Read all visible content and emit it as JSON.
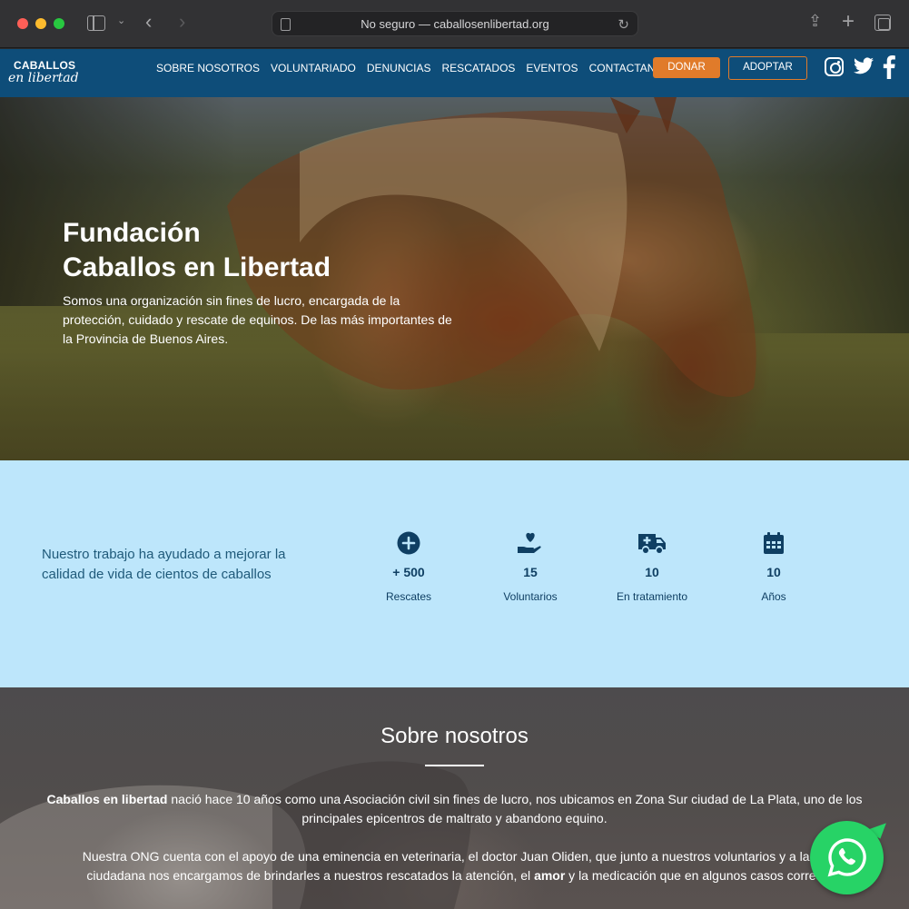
{
  "browser": {
    "url_text": "No seguro — caballosenlibertad.org"
  },
  "site": {
    "logo_line1": "CABALLOS",
    "logo_line2": "en libertad",
    "nav": [
      {
        "label": "SOBRE NOSOTROS"
      },
      {
        "label": "VOLUNTARIADO"
      },
      {
        "label": "DENUNCIAS"
      },
      {
        "label": "RESCATADOS"
      },
      {
        "label": "EVENTOS"
      },
      {
        "label": "CONTACTANOS"
      }
    ],
    "donate_label": "DONAR",
    "adopt_label": "ADOPTAR",
    "social_icons": [
      "instagram-icon",
      "twitter-icon",
      "facebook-icon"
    ]
  },
  "hero": {
    "title_line1": "Fundación",
    "title_line2": "Caballos en Libertad",
    "description": "Somos una organización sin fines de lucro, encargada de la protección, cuidado y rescate de equinos. De las más importantes de la Provincia de Buenos Aires."
  },
  "stats": {
    "intro": "Nuestro trabajo ha ayudado a mejorar la calidad de vida de cientos de caballos",
    "items": [
      {
        "icon": "plus-circle-icon",
        "value": "+ 500",
        "label": "Rescates"
      },
      {
        "icon": "hand-heart-icon",
        "value": "15",
        "label": "Voluntarios"
      },
      {
        "icon": "ambulance-icon",
        "value": "10",
        "label": "En tratamiento"
      },
      {
        "icon": "calendar-icon",
        "value": "10",
        "label": "Años"
      }
    ]
  },
  "about": {
    "title": "Sobre nosotros",
    "p1_bold": "Caballos en libertad",
    "p1_rest": " nació hace 10 años como una Asociación civil sin fines de lucro, nos ubicamos en Zona Sur ciudad de La Plata, uno de los principales epicentros de maltrato y abandono equino.",
    "p2_start": "Nuestra ONG cuenta con el apoyo de una eminencia en veterinaria, el doctor Juan Oliden, que junto a nuestros voluntarios y a la co",
    "p2_line2_a": "ciudadana nos encargamos de brindarles a nuestros rescatados la atención, el ",
    "p2_bold": "amor",
    "p2_line2_b": " y la medicación que en algunos casos corres"
  },
  "colors": {
    "nav_bg": "#0e4d79",
    "accent": "#e07b2a",
    "stats_bg": "#bde6fb",
    "stats_text": "#0f3f63",
    "whatsapp": "#27d366"
  }
}
